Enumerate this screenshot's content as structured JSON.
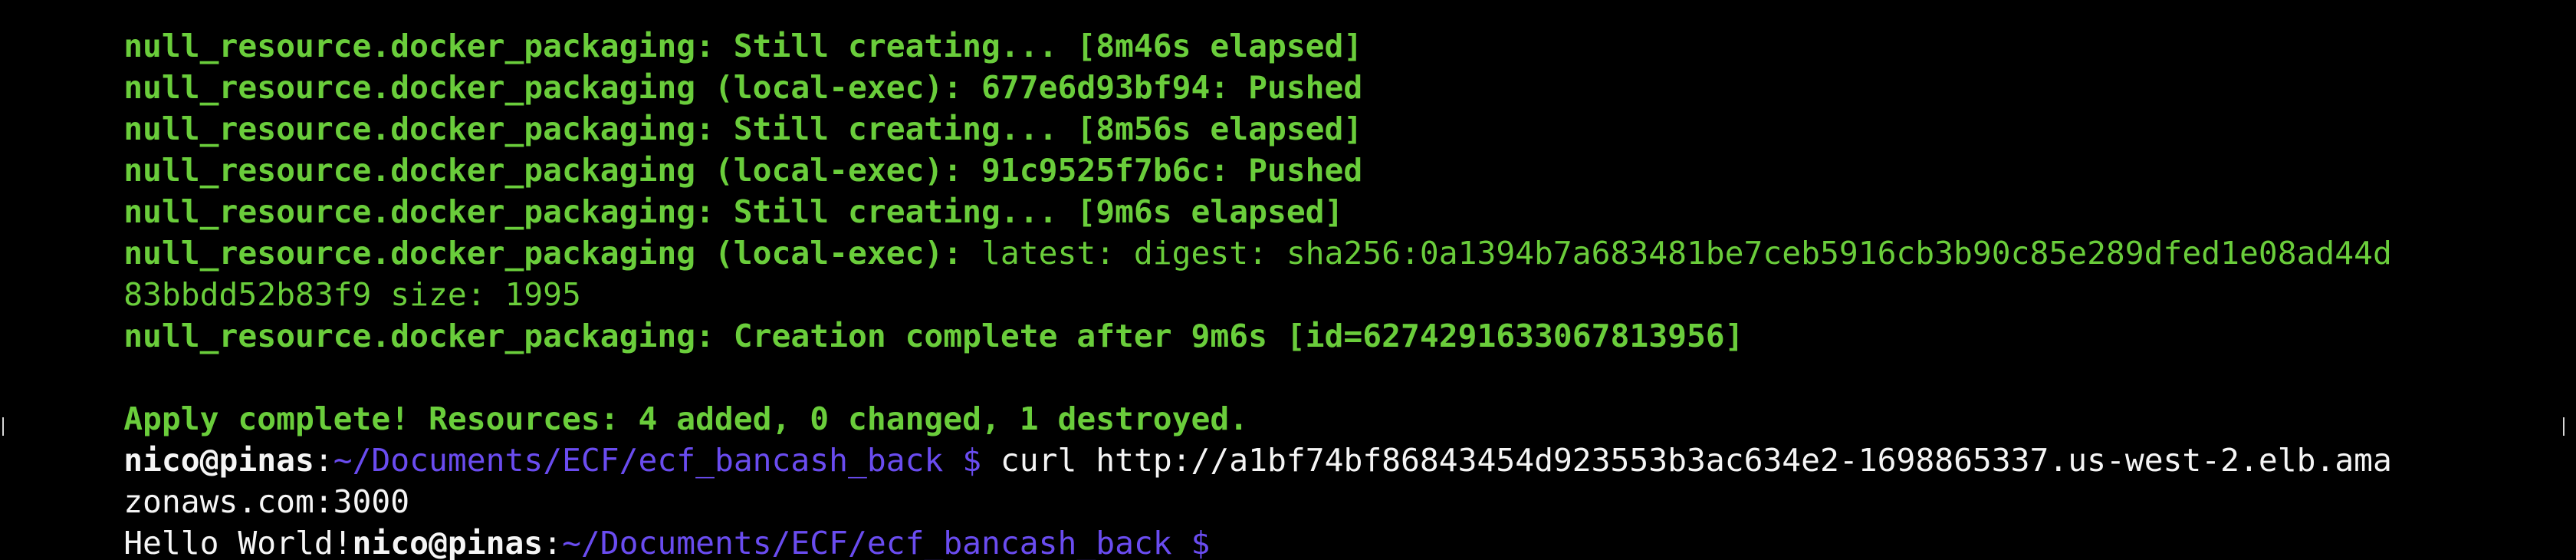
{
  "colors": {
    "background": "#000000",
    "output_green": "#6acd3b",
    "prompt_user": "#f5f5f5",
    "prompt_path": "#6a4cf0",
    "command_text": "#f5f5f5"
  },
  "lines": [
    {
      "text": "null_resource.docker_packaging: Still creating... [8m46s elapsed]"
    },
    {
      "text": "null_resource.docker_packaging (local-exec): 677e6d93bf94: Pushed"
    },
    {
      "text": "null_resource.docker_packaging: Still creating... [8m56s elapsed]"
    },
    {
      "text": "null_resource.docker_packaging (local-exec): 91c9525f7b6c: Pushed"
    },
    {
      "text": "null_resource.docker_packaging: Still creating... [9m6s elapsed]"
    },
    {
      "prefix": "null_resource.docker_packaging (local-exec):",
      "rest": " latest: digest: sha256:0a1394b7a683481be7ceb5916cb3b90c85e289dfed1e08ad44d"
    },
    {
      "text": "83bbdd52b83f9 size: 1995"
    },
    {
      "text": "null_resource.docker_packaging: Creation complete after 9m6s [id=6274291633067813956]"
    },
    {
      "text": ""
    },
    {
      "text": "Apply complete! Resources: 4 added, 0 changed, 1 destroyed."
    },
    {
      "user": "nico@pinas",
      "sep": ":",
      "path": "~/Documents/ECF/ecf_bancash_back",
      "dollar": " $",
      "command": " curl http://a1bf74bf86843454d923553b3ac634e2-1698865337.us-west-2.elb.ama"
    },
    {
      "text": "zonaws.com:3000"
    },
    {
      "output": "Hello World!",
      "user": "nico@pinas",
      "sep": ":",
      "path": "~/Documents/ECF/ecf_bancash_back",
      "dollar": " $"
    }
  ]
}
